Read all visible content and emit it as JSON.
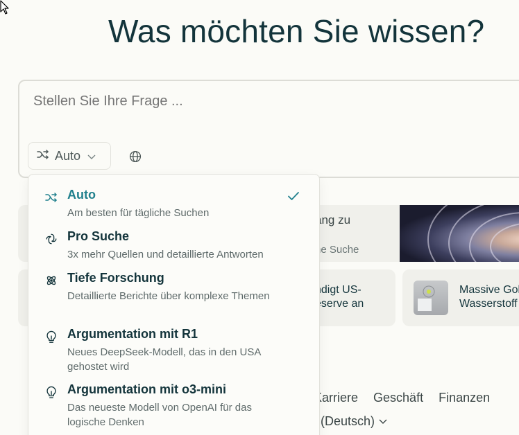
{
  "heading": "Was möchten Sie wissen?",
  "search": {
    "placeholder": "Stellen Sie Ihre Frage ..."
  },
  "mode_button": {
    "label": "Auto"
  },
  "dropdown": {
    "options": [
      {
        "title": "Auto",
        "description": "Am besten für tägliche Suchen",
        "icon": "shuffle-icon",
        "selected": true
      },
      {
        "title": "Pro Suche",
        "description": "3x mehr Quellen und detaillierte Antworten",
        "icon": "pro-search-icon",
        "selected": false
      },
      {
        "title": "Tiefe Forschung",
        "description": "Detaillierte Berichte über komplexe Themen",
        "icon": "atom-icon",
        "selected": false
      },
      {
        "title": "Argumentation mit R1",
        "description": "Neues DeepSeek-Modell, das in den USA gehostet wird",
        "icon": "lightbulb-icon",
        "selected": false
      },
      {
        "title": "Argumentation mit o3-mini",
        "description": "Das neueste Modell von OpenAI für das logische Denken",
        "icon": "lightbulb-icon",
        "selected": false
      }
    ]
  },
  "banner": {
    "line1": "ang zu",
    "line2": "ne Suche"
  },
  "news": [
    {
      "line1": "ndigt US-",
      "line2": "eserve an"
    },
    {
      "line1": "Massive Gol",
      "line2": "Wasserstoff"
    }
  ],
  "topics": [
    "Karriere",
    "Geschäft",
    "Finanzen"
  ],
  "language": "(Deutsch)",
  "colors": {
    "accent": "#20808d",
    "text": "#13343b",
    "background": "#fbfbf7"
  }
}
